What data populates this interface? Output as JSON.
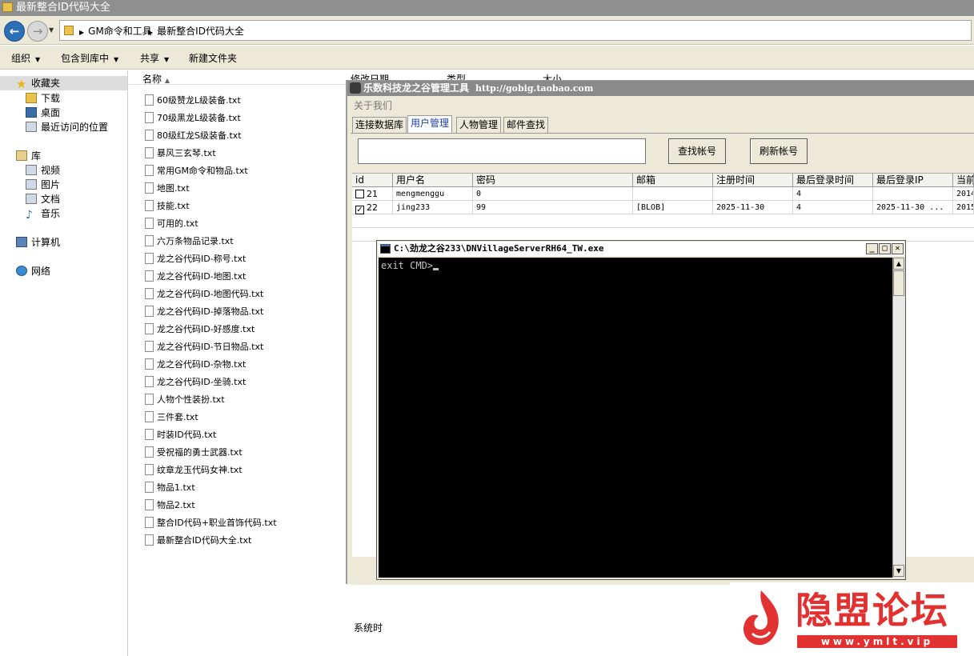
{
  "explorer": {
    "title": "最新整合ID代码大全",
    "breadcrumb": [
      "GM命令和工具",
      "最新整合ID代码大全"
    ],
    "toolbar": {
      "organize": "组织",
      "include": "包含到库中",
      "share": "共享",
      "new_folder": "新建文件夹"
    },
    "nav": {
      "favorites": "收藏夹",
      "downloads": "下载",
      "desktop": "桌面",
      "recent": "最近访问的位置",
      "libraries": "库",
      "videos": "视频",
      "pictures": "图片",
      "documents": "文档",
      "music": "音乐",
      "computer": "计算机",
      "network": "网络"
    },
    "columns": {
      "name": "名称",
      "modified": "修改日期",
      "type": "类型",
      "size": "大小"
    },
    "files": [
      "60级赞龙L级装备.txt",
      "70级黑龙L级装备.txt",
      "80级红龙S级装备.txt",
      "暴风三玄琴.txt",
      "常用GM命令和物品.txt",
      "地图.txt",
      "技能.txt",
      "可用的.txt",
      "六万条物品记录.txt",
      "龙之谷代码ID-称号.txt",
      "龙之谷代码ID-地图.txt",
      "龙之谷代码ID-地图代码.txt",
      "龙之谷代码ID-掉落物品.txt",
      "龙之谷代码ID-好感度.txt",
      "龙之谷代码ID-节日物品.txt",
      "龙之谷代码ID-杂物.txt",
      "龙之谷代码ID-坐骑.txt",
      "人物个性装扮.txt",
      "三件套.txt",
      "时装ID代码.txt",
      "受祝福的勇士武器.txt",
      "纹章龙玉代码女神.txt",
      "物品1.txt",
      "物品2.txt",
      "整合ID代码+职业首饰代码.txt",
      "最新整合ID代码大全.txt"
    ]
  },
  "tool": {
    "title": "乐数科技龙之谷管理工具",
    "url": "http://gobig.taobao.com",
    "menu_about": "关于我们",
    "tabs": [
      "连接数据库",
      "用户管理",
      "人物管理",
      "邮件查找"
    ],
    "search_placeholder": "",
    "find_button": "查找帐号",
    "refresh_button": "刷新帐号",
    "table": {
      "headers": [
        "id",
        "用户名",
        "密码",
        "邮箱",
        "注册时间",
        "最后登录时间",
        "最后登录IP",
        "当前"
      ],
      "rows": [
        {
          "checked": false,
          "cells": [
            "21",
            "mengmenggu",
            "0",
            "",
            "",
            "4",
            "",
            "2014"
          ]
        },
        {
          "checked": true,
          "cells": [
            "22",
            "jing233",
            "99",
            "[BLOB]",
            "2025-11-30",
            "4",
            "2025-11-30 ...",
            "2015"
          ]
        }
      ]
    },
    "status": "系统时"
  },
  "console": {
    "title": "C:\\劲龙之谷233\\DNVillageServerRH64_TW.exe",
    "line": "exit CMD>"
  },
  "watermark": {
    "title": "隐盟论坛",
    "url": "www.ymlt.vip"
  },
  "colors": {
    "accent_red": "#e23131",
    "titlebar_gray": "#8a8a8a",
    "console_bg": "#000000"
  }
}
